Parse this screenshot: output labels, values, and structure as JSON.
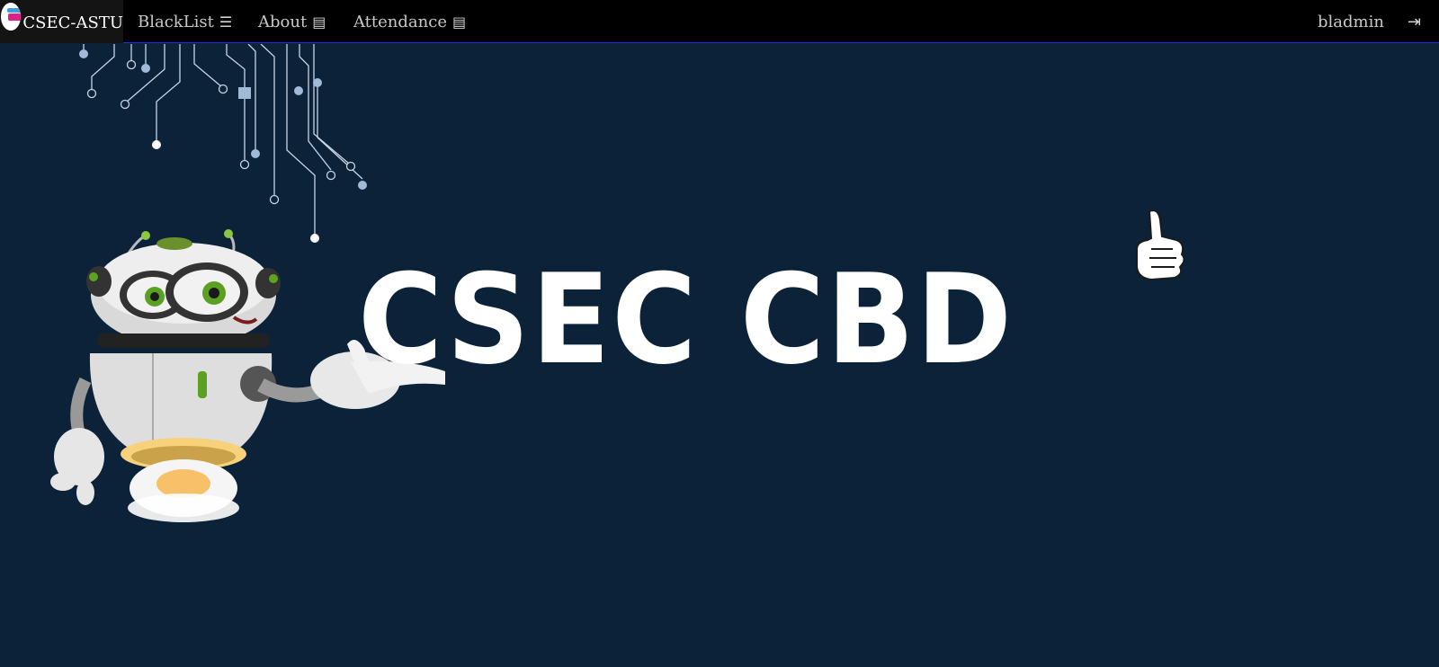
{
  "navbar": {
    "brand": "CSEC-ASTU",
    "items": [
      {
        "label": "BlackList",
        "icon": "list-icon"
      },
      {
        "label": "About",
        "icon": "list-alt-icon"
      },
      {
        "label": "Attendance",
        "icon": "list-alt-icon"
      }
    ],
    "user": "bladmin",
    "logout_icon": "sign-out-icon"
  },
  "hero": {
    "title": "CSEC CBD"
  },
  "colors": {
    "navbar_bg": "#000000",
    "page_bg": "#0b2239",
    "nav_border": "#1a2cff",
    "title": "#ffffff"
  }
}
